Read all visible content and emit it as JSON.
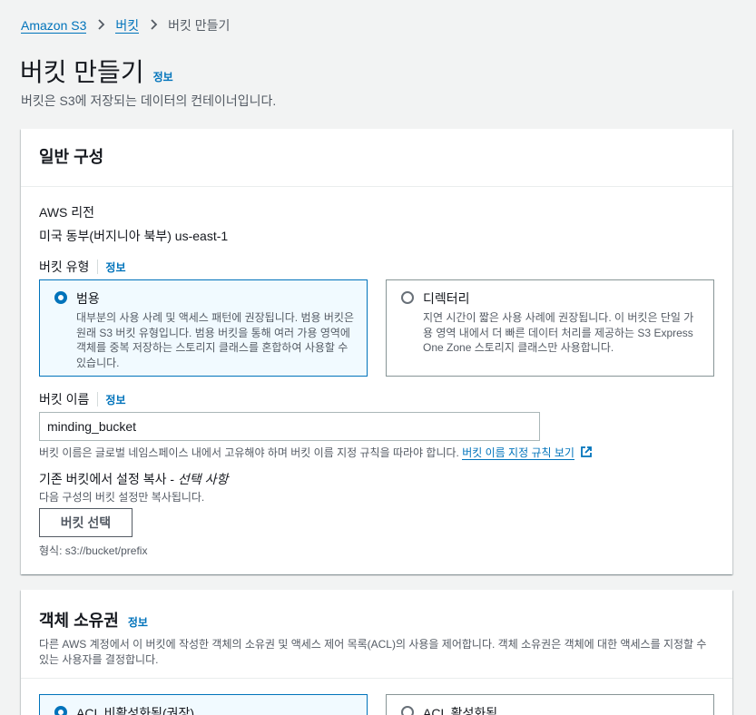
{
  "breadcrumb": {
    "root": "Amazon S3",
    "parent": "버킷",
    "current": "버킷 만들기"
  },
  "page": {
    "title": "버킷 만들기",
    "info": "정보",
    "description": "버킷은 S3에 저장되는 데이터의 컨테이너입니다."
  },
  "general": {
    "title": "일반 구성",
    "region_label": "AWS 리전",
    "region_value": "미국 동부(버지니아 북부) us-east-1",
    "bucket_type_label": "버킷 유형",
    "bucket_type_info": "정보",
    "tiles": [
      {
        "title": "범용",
        "desc": "대부분의 사용 사례 및 액세스 패턴에 권장됩니다. 범용 버킷은 원래 S3 버킷 유형입니다. 범용 버킷을 통해 여러 가용 영역에 객체를 중복 저장하는 스토리지 클래스를 혼합하여 사용할 수 있습니다.",
        "selected": true
      },
      {
        "title": "디렉터리",
        "desc": "지연 시간이 짧은 사용 사례에 권장됩니다. 이 버킷은 단일 가용 영역 내에서 더 빠른 데이터 처리를 제공하는 S3 Express One Zone 스토리지 클래스만 사용합니다.",
        "selected": false
      }
    ],
    "bucket_name_label": "버킷 이름",
    "bucket_name_info": "정보",
    "bucket_name_value": "minding_bucket",
    "bucket_name_hint": "버킷 이름은 글로벌 네임스페이스 내에서 고유해야 하며 버킷 이름 지정 규칙을 따라야 합니다.",
    "bucket_name_rules_link": "버킷 이름 지정 규칙 보기",
    "copy_label": "기존 버킷에서 설정 복사 - ",
    "copy_optional": "선택 사항",
    "copy_desc": "다음 구성의 버킷 설정만 복사됩니다.",
    "choose_bucket_button": "버킷 선택",
    "format_hint": "형식: s3://bucket/prefix"
  },
  "ownership": {
    "title": "객체 소유권",
    "info": "정보",
    "description": "다른 AWS 계정에서 이 버킷에 작성한 객체의 소유권 및 액세스 제어 목록(ACL)의 사용을 제어합니다. 객체 소유권은 객체에 대한 액세스를 지정할 수 있는 사용자를 결정합니다.",
    "tiles": [
      {
        "title": "ACL 비활성화됨(권장)",
        "selected": true
      },
      {
        "title": "ACL 활성화됨",
        "selected": false
      }
    ]
  },
  "colors": {
    "accent": "#0073bb",
    "page_bg": "#f2f3f3",
    "selected_tile_bg": "#f1faff"
  }
}
